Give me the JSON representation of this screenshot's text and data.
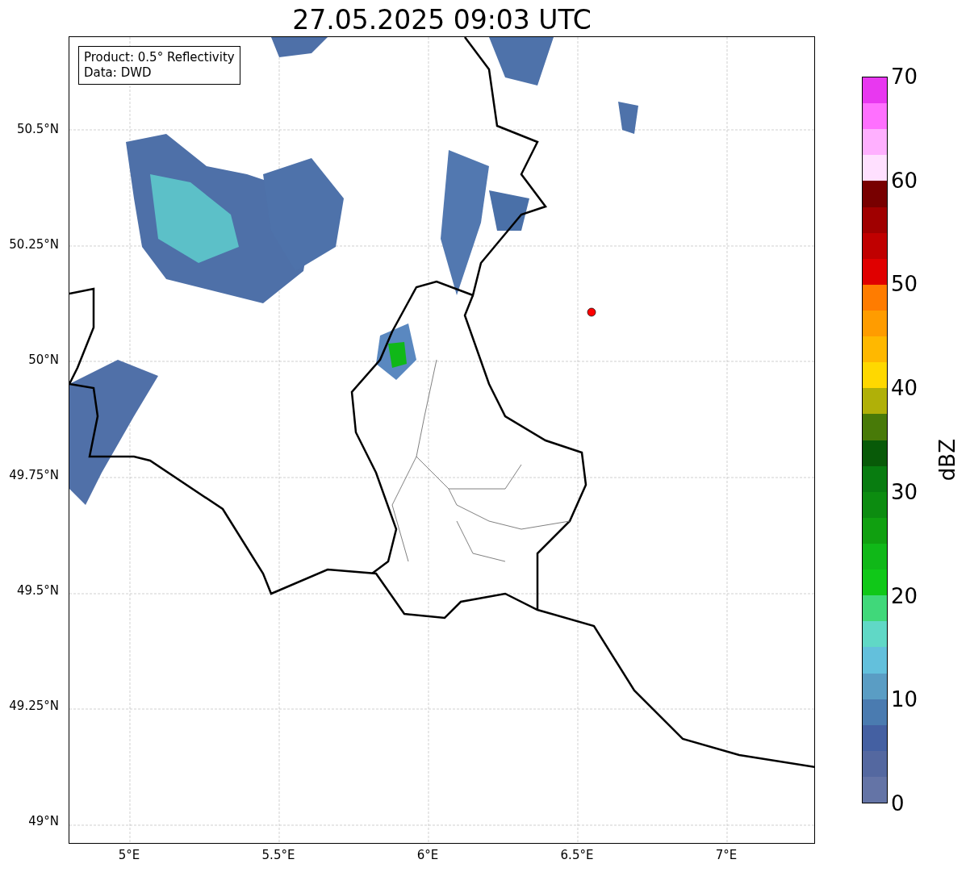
{
  "title": "27.05.2025 09:03 UTC",
  "map": {
    "legend": [
      "Product: 0.5° Reflectivity",
      "Data: DWD"
    ],
    "y_ticks": [
      "50.5°N",
      "50.25°N",
      "50°N",
      "49.75°N",
      "49.5°N",
      "49.25°N",
      "49°N"
    ],
    "x_ticks": [
      "5°E",
      "5.5°E",
      "6°E",
      "6.5°E",
      "7°E"
    ]
  },
  "colorbar": {
    "label": "dBZ",
    "ticks": [
      "70",
      "60",
      "50",
      "40",
      "30",
      "20",
      "10",
      "0"
    ],
    "bands": [
      {
        "color": "#6474a6"
      },
      {
        "color": "#5468a0"
      },
      {
        "color": "#4460a2"
      },
      {
        "color": "#4a7bb0"
      },
      {
        "color": "#5a9dc4"
      },
      {
        "color": "#63c0dc"
      },
      {
        "color": "#60d8c6"
      },
      {
        "color": "#40d87a"
      },
      {
        "color": "#10c818"
      },
      {
        "color": "#10b818"
      },
      {
        "color": "#10a010"
      },
      {
        "color": "#0c8c10"
      },
      {
        "color": "#087c10"
      },
      {
        "color": "#085a08"
      },
      {
        "color": "#487a08"
      },
      {
        "color": "#b0b008"
      },
      {
        "color": "#ffd800"
      },
      {
        "color": "#ffb800"
      },
      {
        "color": "#ff9c00"
      },
      {
        "color": "#ff7c00"
      },
      {
        "color": "#e00000"
      },
      {
        "color": "#c00000"
      },
      {
        "color": "#a00000"
      },
      {
        "color": "#780000"
      },
      {
        "color": "#ffe0ff"
      },
      {
        "color": "#ffb0ff"
      },
      {
        "color": "#ff70ff"
      },
      {
        "color": "#e838f0"
      }
    ]
  }
}
